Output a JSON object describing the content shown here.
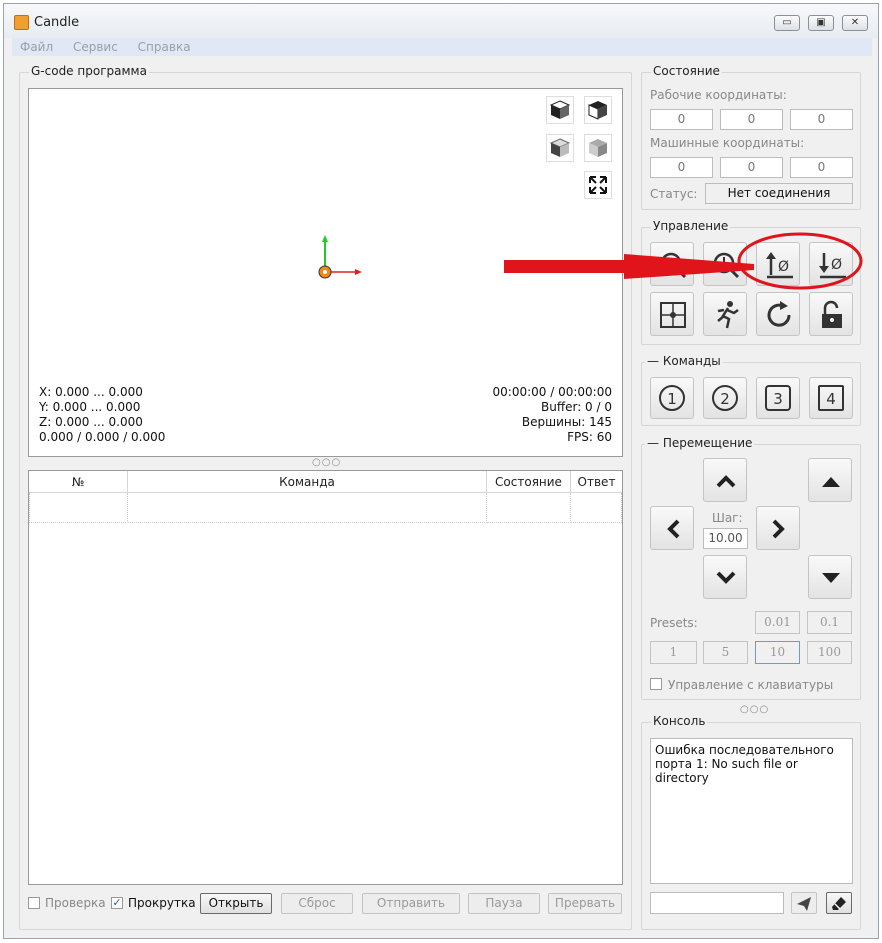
{
  "window": {
    "title": "Candle",
    "app_icon_glyph": "🔥",
    "minimize_glyph": "▭",
    "maximize_glyph": "▣",
    "close_glyph": "✕"
  },
  "menu": [
    "Файл",
    "Сервис",
    "Справка"
  ],
  "gcode_panel": {
    "title": "G-code программа",
    "overlay_left": [
      "X: 0.000 ... 0.000",
      "Y: 0.000 ... 0.000",
      "Z: 0.000 ... 0.000",
      "0.000 / 0.000 / 0.000"
    ],
    "overlay_right": [
      "00:00:00 / 00:00:00",
      "Buffer: 0 / 0",
      "Вершины: 145",
      "FPS: 60"
    ]
  },
  "splitter_glyph": "○○○",
  "table": {
    "headers": [
      "№",
      "Команда",
      "Состояние",
      "Ответ"
    ]
  },
  "bottom_bar": {
    "check_label": "Проверка",
    "scroll_label": "Прокрутка",
    "scroll_checked": true,
    "check_mark": "✓",
    "buttons": [
      "Открыть",
      "Сброс",
      "Отправить",
      "Пауза",
      "Прервать"
    ]
  },
  "state": {
    "title": "Состояние",
    "work_coords_label": "Рабочие координаты:",
    "work_coords": [
      "0",
      "0",
      "0"
    ],
    "machine_coords_label": "Машинные координаты:",
    "machine_coords": [
      "0",
      "0",
      "0"
    ],
    "status_label": "Статус:",
    "status_value": "Нет соединения"
  },
  "control": {
    "title": "Управление"
  },
  "commands": {
    "title": "Команды",
    "collapse_glyph": "—",
    "buttons": [
      "1",
      "2",
      "3",
      "4"
    ]
  },
  "movement": {
    "title": "Перемещение",
    "collapse_glyph": "—",
    "step_label": "Шаг:",
    "step_value": "10.00",
    "presets_label": "Presets:",
    "presets_row1": [
      "0.01",
      "0.1"
    ],
    "presets_row2": [
      "1",
      "5",
      "10",
      "100"
    ],
    "keyboard_label": "Управление с клавиатуры"
  },
  "console": {
    "title": "Консоль",
    "text": "Ошибка последовательного порта 1: No such file or directory"
  },
  "colors": {
    "annotation_red": "#e0151b",
    "axis_x": "#e02020",
    "axis_y": "#22cc22",
    "origin": "#f08a10"
  }
}
